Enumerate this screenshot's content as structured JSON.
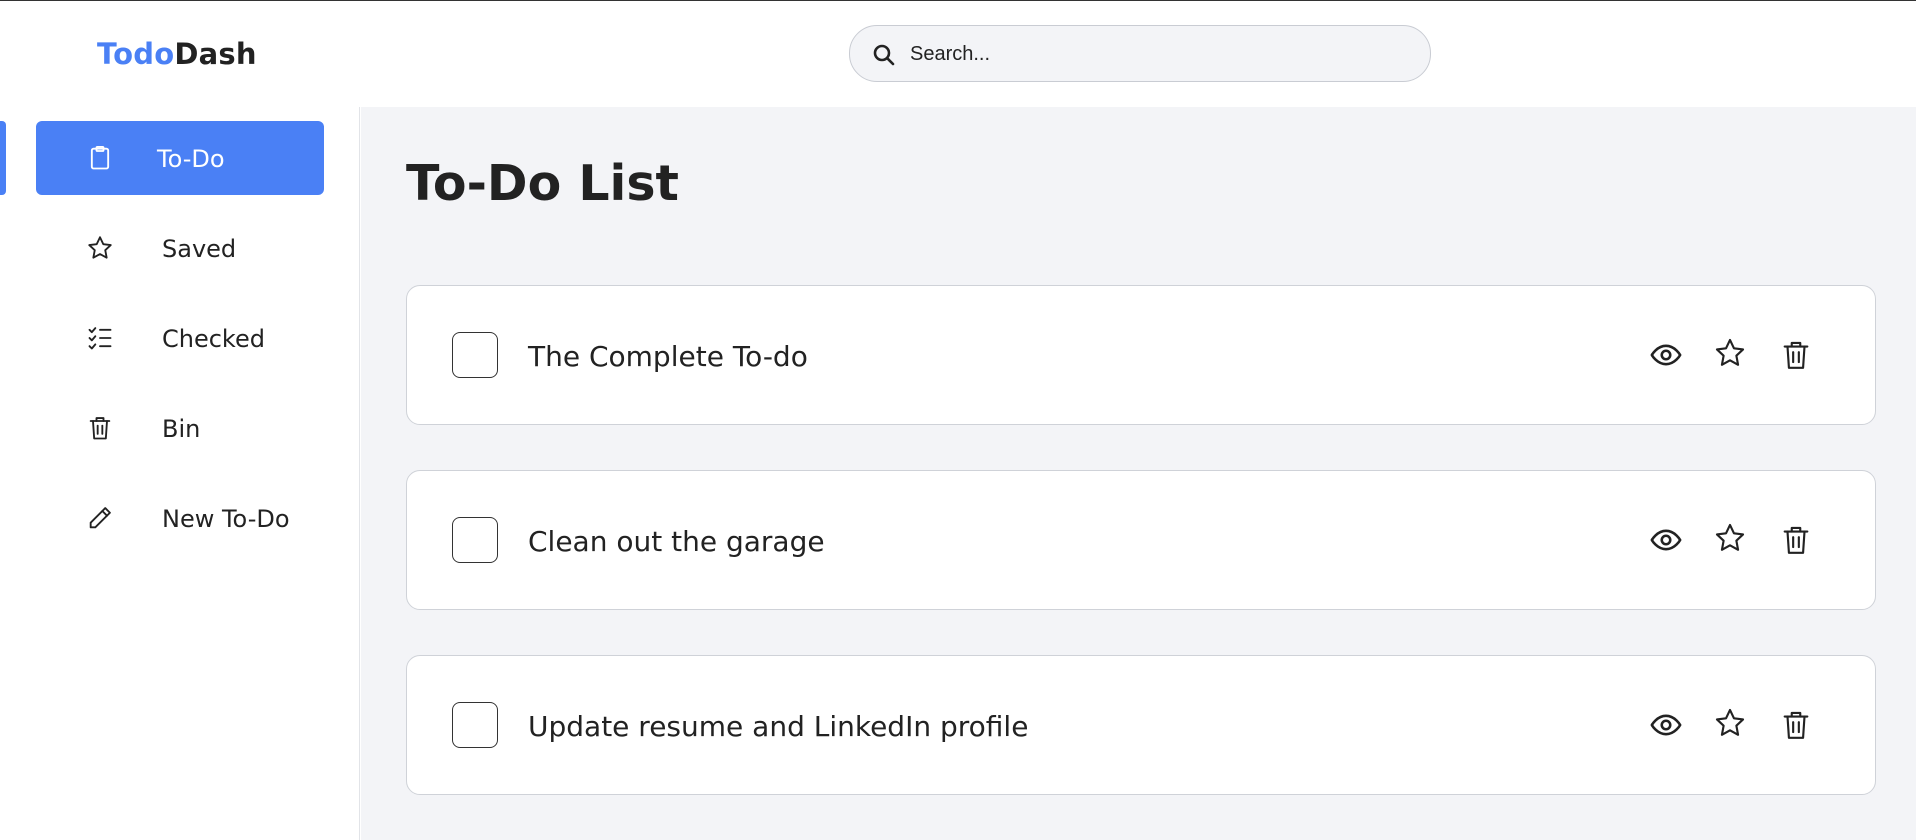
{
  "header": {
    "logo_part1": "Todo",
    "logo_part2": "Dash",
    "search_placeholder": "Search..."
  },
  "sidebar": {
    "items": [
      {
        "label": "To-Do",
        "icon": "clipboard-icon",
        "active": true
      },
      {
        "label": "Saved",
        "icon": "star-icon",
        "active": false
      },
      {
        "label": "Checked",
        "icon": "checklist-icon",
        "active": false
      },
      {
        "label": "Bin",
        "icon": "trash-icon",
        "active": false
      },
      {
        "label": "New To-Do",
        "icon": "pencil-icon",
        "active": false
      }
    ]
  },
  "main": {
    "title": "To-Do List",
    "todos": [
      {
        "title": "The Complete To-do",
        "checked": false
      },
      {
        "title": "Clean out the garage",
        "checked": false
      },
      {
        "title": "Update resume and LinkedIn profile",
        "checked": false
      }
    ],
    "actions": [
      "eye-icon",
      "star-icon",
      "trash-icon"
    ]
  },
  "colors": {
    "accent": "#4a80f5",
    "background": "#f3f4f7",
    "text": "#222222"
  }
}
